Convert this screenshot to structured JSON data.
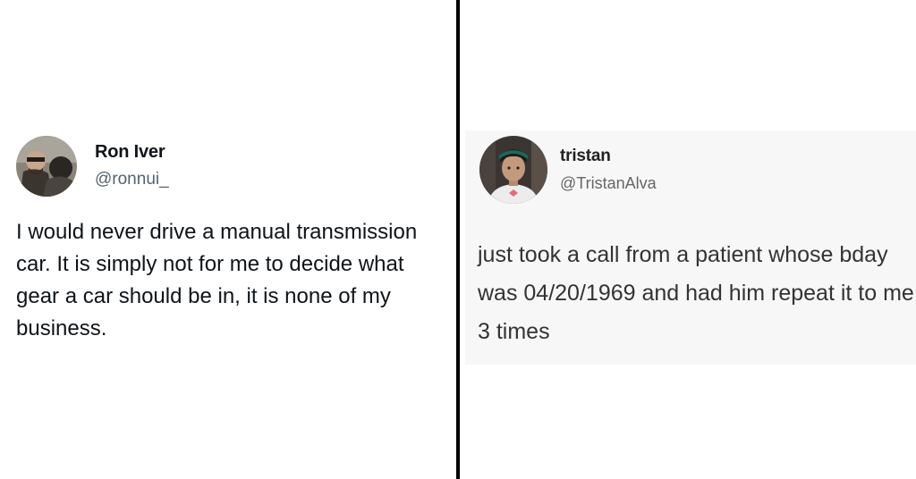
{
  "left_tweet": {
    "display_name": "Ron Iver",
    "handle": "@ronnui_",
    "text": "I would never drive a manual transmission car. It is simply not for me to decide what gear a car should be in, it is none of my business.",
    "avatar_icon": "user-avatar-photo"
  },
  "right_tweet": {
    "display_name": "tristan",
    "handle": "@TristanAlva",
    "text": "just took a call from a patient whose bday was 04/20/1969 and had him repeat it to me 3 times",
    "avatar_icon": "user-avatar-photo"
  },
  "colors": {
    "divider": "#000000",
    "handle_gray": "#536471",
    "right_panel_bg": "#f7f7f7"
  }
}
